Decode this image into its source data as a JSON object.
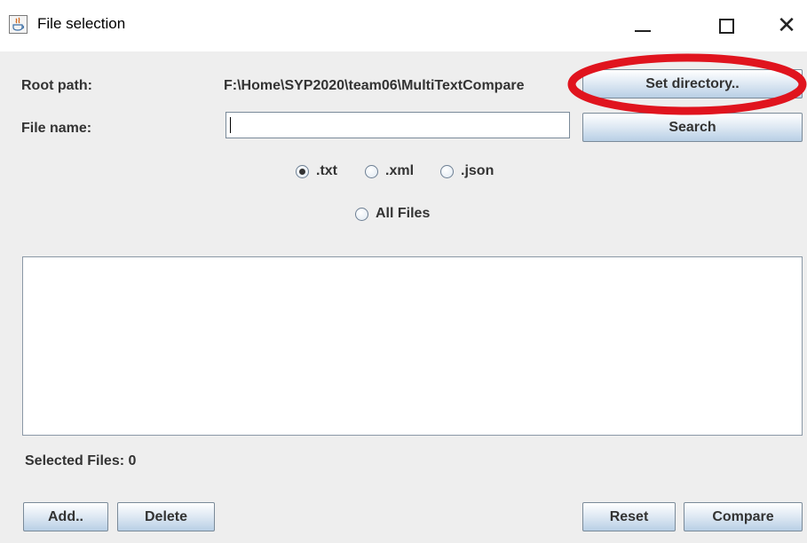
{
  "window": {
    "title": "File selection",
    "app_icon": "java-icon",
    "controls": [
      "minimize-icon",
      "maximize-icon",
      "close-icon"
    ]
  },
  "form": {
    "root_label": "Root path:",
    "root_path": "F:\\Home\\SYP2020\\team06\\MultiTextCompare",
    "set_directory_label": "Set directory..",
    "file_name_label": "File name:",
    "file_name_value": "",
    "search_label": "Search"
  },
  "filters": {
    "options": [
      {
        "label": ".txt",
        "checked": true
      },
      {
        "label": ".xml",
        "checked": false
      },
      {
        "label": ".json",
        "checked": false
      },
      {
        "label": "All Files",
        "checked": false
      }
    ]
  },
  "selection": {
    "label": "Selected Files: 0"
  },
  "actions": {
    "add_label": "Add..",
    "delete_label": "Delete",
    "reset_label": "Reset",
    "compare_label": "Compare"
  },
  "colors": {
    "highlight": "#e0141e",
    "panel": "#eeeeee",
    "button_text": "#333333"
  }
}
